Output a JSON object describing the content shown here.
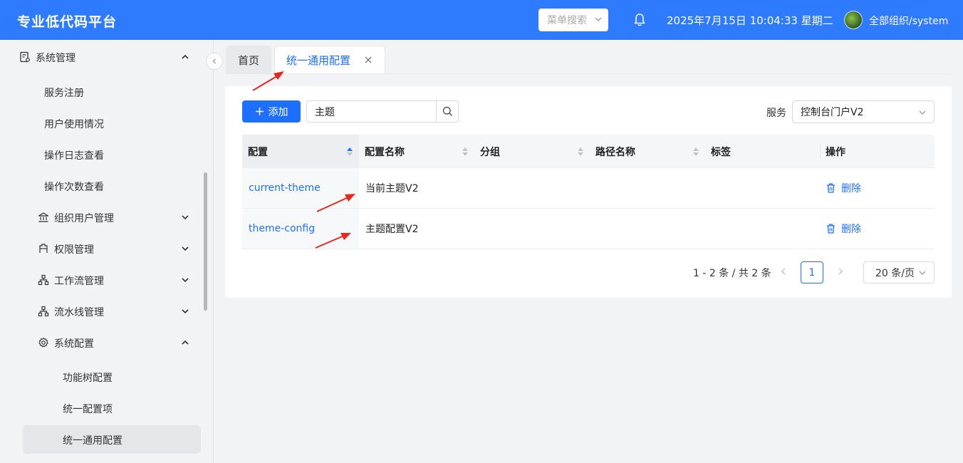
{
  "header": {
    "brand": "专业低代码平台",
    "menu_search_placeholder": "菜单搜索",
    "datetime": "2025年7月15日 10:04:33 星期二",
    "org": "全部组织/system"
  },
  "sidebar": {
    "items": [
      {
        "label": "系统管理",
        "icon": "clipboard-gear-icon",
        "state": "expanded"
      },
      {
        "label": "服务注册"
      },
      {
        "label": "用户使用情况"
      },
      {
        "label": "操作日志查看"
      },
      {
        "label": "操作次数查看"
      },
      {
        "label": "组织用户管理",
        "icon": "bank-icon",
        "state": "collapsed"
      },
      {
        "label": "权限管理",
        "icon": "permission-icon",
        "state": "collapsed"
      },
      {
        "label": "工作流管理",
        "icon": "hierarchy-icon",
        "state": "collapsed"
      },
      {
        "label": "流水线管理",
        "icon": "hierarchy-icon",
        "state": "collapsed"
      },
      {
        "label": "系统配置",
        "icon": "gear-icon",
        "state": "expanded"
      },
      {
        "label": "功能树配置"
      },
      {
        "label": "统一配置项"
      },
      {
        "label": "统一通用配置",
        "active": true
      }
    ]
  },
  "tabs": [
    {
      "label": "首页"
    },
    {
      "label": "统一通用配置",
      "active": true
    }
  ],
  "toolbar": {
    "add_label": "添加",
    "search_value": "主题",
    "service_label": "服务",
    "service_value": "控制台门户V2"
  },
  "table": {
    "columns": [
      "配置",
      "配置名称",
      "分组",
      "路径名称",
      "标签",
      "操作"
    ],
    "rows": [
      {
        "key": "current-theme",
        "name": "当前主题V2",
        "group": "",
        "path": "",
        "tag": "",
        "action": "删除"
      },
      {
        "key": "theme-config",
        "name": "主题配置V2",
        "group": "",
        "path": "",
        "tag": "",
        "action": "删除"
      }
    ]
  },
  "pagination": {
    "total_text": "1 - 2 条 / 共 2 条",
    "current_page": "1",
    "page_size": "20 条/页"
  },
  "colors": {
    "primary": "#1f6fff",
    "header_bg": "#2f7bff",
    "annotation_arrow": "#e8281e"
  }
}
